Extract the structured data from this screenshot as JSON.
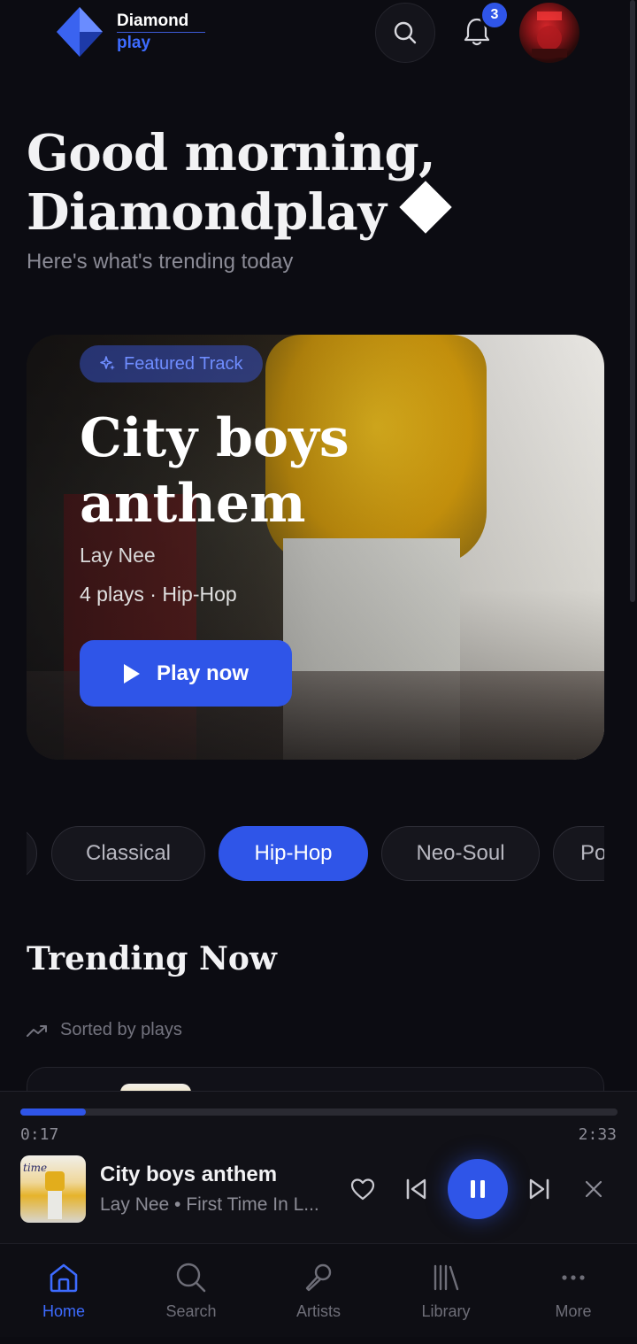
{
  "header": {
    "brand_line1": "Diamond",
    "brand_line2": "play",
    "notification_count": "3",
    "icons": [
      "diamond-logo-icon",
      "search-icon",
      "bell-icon",
      "avatar"
    ]
  },
  "greeting": {
    "line1": "Good morning,",
    "line2": "Diamondplay",
    "subtitle": "Here's what's trending today"
  },
  "featured": {
    "tag": "Featured Track",
    "title": "City boys anthem",
    "artist": "Lay Nee",
    "meta": "4 plays · Hip-Hop",
    "play_label": "Play now"
  },
  "genres": {
    "items": [
      {
        "label": ""
      },
      {
        "label": "Classical"
      },
      {
        "label": "Hip-Hop",
        "active": true
      },
      {
        "label": "Neo-Soul"
      },
      {
        "label": "Po"
      }
    ]
  },
  "trending": {
    "title": "Trending Now",
    "sorted_label": "Sorted by plays"
  },
  "player": {
    "current_time": "0:17",
    "total_time": "2:33",
    "progress": 0.11,
    "title": "City boys anthem",
    "subtitle": "Lay Nee • First Time In L..."
  },
  "tabs": [
    {
      "label": "Home",
      "icon": "home-icon",
      "active": true
    },
    {
      "label": "Search",
      "icon": "search-icon"
    },
    {
      "label": "Artists",
      "icon": "microphone-icon"
    },
    {
      "label": "Library",
      "icon": "library-icon"
    },
    {
      "label": "More",
      "icon": "more-icon"
    }
  ],
  "colors": {
    "accent": "#2f55e8",
    "background": "#0c0c12"
  }
}
